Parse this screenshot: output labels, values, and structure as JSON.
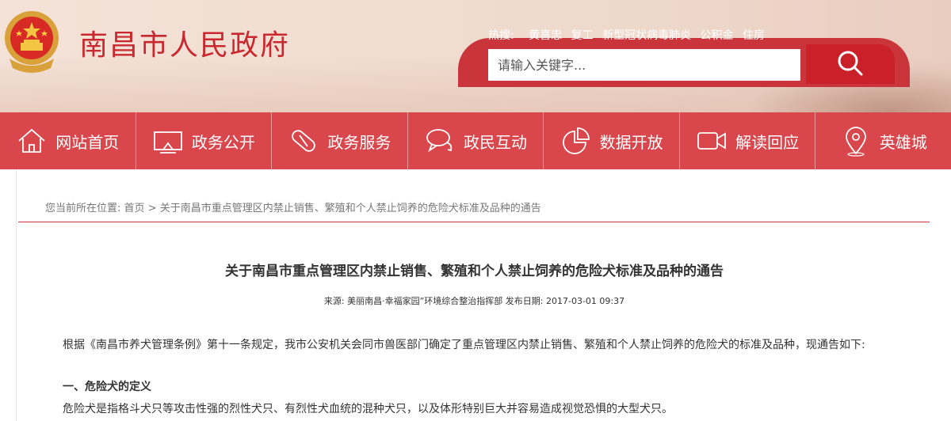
{
  "header": {
    "site_title": "南昌市人民政府",
    "hot_label": "热搜:",
    "hot_links": [
      "黄喜忠",
      "复工",
      "新型冠状病毒肺炎",
      "公积金",
      "住房"
    ],
    "search_placeholder": "请输入关键字...",
    "colors": {
      "brand_red": "#c9202a",
      "nav_red": "#d9464c"
    }
  },
  "nav": {
    "items": [
      {
        "label": "网站首页",
        "icon": "home-icon"
      },
      {
        "label": "政务公开",
        "icon": "screen-icon"
      },
      {
        "label": "政务服务",
        "icon": "capsule-icon"
      },
      {
        "label": "政民互动",
        "icon": "chat-icon"
      },
      {
        "label": "数据开放",
        "icon": "pie-chart-icon"
      },
      {
        "label": "解读回应",
        "icon": "video-icon"
      },
      {
        "label": "英雄城",
        "icon": "location-pin-icon"
      }
    ]
  },
  "breadcrumb": {
    "prefix": "您当前所在位置:",
    "home": "首页",
    "separator": ">",
    "current": "关于南昌市重点管理区内禁止销售、繁殖和个人禁止饲养的危险犬标准及品种的通告"
  },
  "article": {
    "title": "关于南昌市重点管理区内禁止销售、繁殖和个人禁止饲养的危险犬标准及品种的通告",
    "source_label": "来源:",
    "source": "美丽南昌·幸福家园”环境综合整治指挥部",
    "date_label": "发布日期:",
    "date": "2017-03-01 09:37",
    "intro": "根据《南昌市养犬管理条例》第十一条规定，我市公安机关会同市兽医部门确定了重点管理区内禁止销售、繁殖和个人禁止饲养的危险犬的标准及品种，现通告如下:",
    "section1_heading": "一、危险犬的定义",
    "section1_text": "危险犬是指格斗犬只等攻击性强的烈性犬只、有烈性犬血统的混种犬只，以及体形特别巨大并容易造成视觉恐惧的大型犬只。"
  }
}
